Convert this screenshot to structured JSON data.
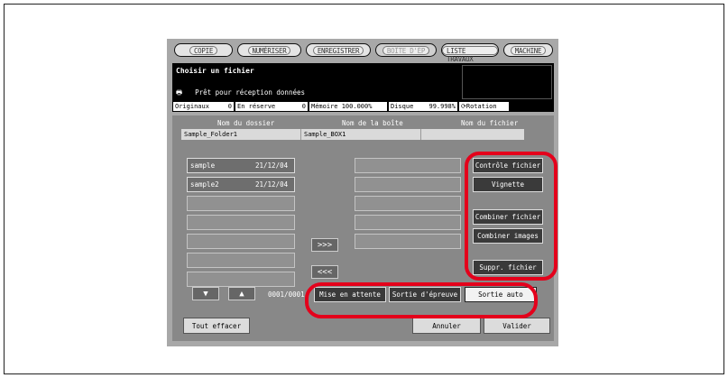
{
  "tabs": [
    {
      "label": "COPIE",
      "active": false
    },
    {
      "label": "NUMÉRISER",
      "active": false
    },
    {
      "label": "ENREGISTRER",
      "active": false
    },
    {
      "label": "BOÎTE D'ÉP",
      "active": true
    },
    {
      "label": "LISTE TRAVAUX",
      "active": false
    },
    {
      "label": "MACHINE",
      "active": false
    }
  ],
  "status": {
    "title": "Choisir un fichier",
    "message": "Prêt pour réception données",
    "printer_icon": "printer-icon"
  },
  "info": {
    "originals_label": "Originaux",
    "originals_value": "0",
    "reserve_label": "En réserve",
    "reserve_value": "0",
    "memory": "Mémoire 100.000%",
    "disk_label": "Disque",
    "disk_value": "99.998%",
    "rotation": "Rotation"
  },
  "columns": {
    "folder": "Nom du dossier",
    "box": "Nom de la boîte",
    "file": "Nom du fichier"
  },
  "path": {
    "folder": "Sample_Folder1",
    "box": "Sample_BOX1",
    "file": ""
  },
  "files": [
    {
      "name": "sample",
      "date": "21/12/04"
    },
    {
      "name": "sample2",
      "date": "21/12/04"
    }
  ],
  "transfer": {
    "add": ">>>",
    "remove": "<<<"
  },
  "actions": {
    "control": "Contrôle fichier",
    "thumbnail": "Vignette",
    "combine_files": "Combiner fichier",
    "combine_images": "Combiner images",
    "delete": "Suppr. fichier"
  },
  "output": {
    "hold": "Mise en attente",
    "proof": "Sortie d'épreuve",
    "auto": "Sortie auto"
  },
  "paging": {
    "down": "▼",
    "up": "▲",
    "counter": "0001/0001"
  },
  "footer": {
    "clear": "Tout effacer",
    "cancel": "Annuler",
    "ok": "Valider"
  },
  "colors": {
    "highlight_ring": "#e4001b",
    "panel": "#a8a8a8",
    "main": "#888888"
  }
}
